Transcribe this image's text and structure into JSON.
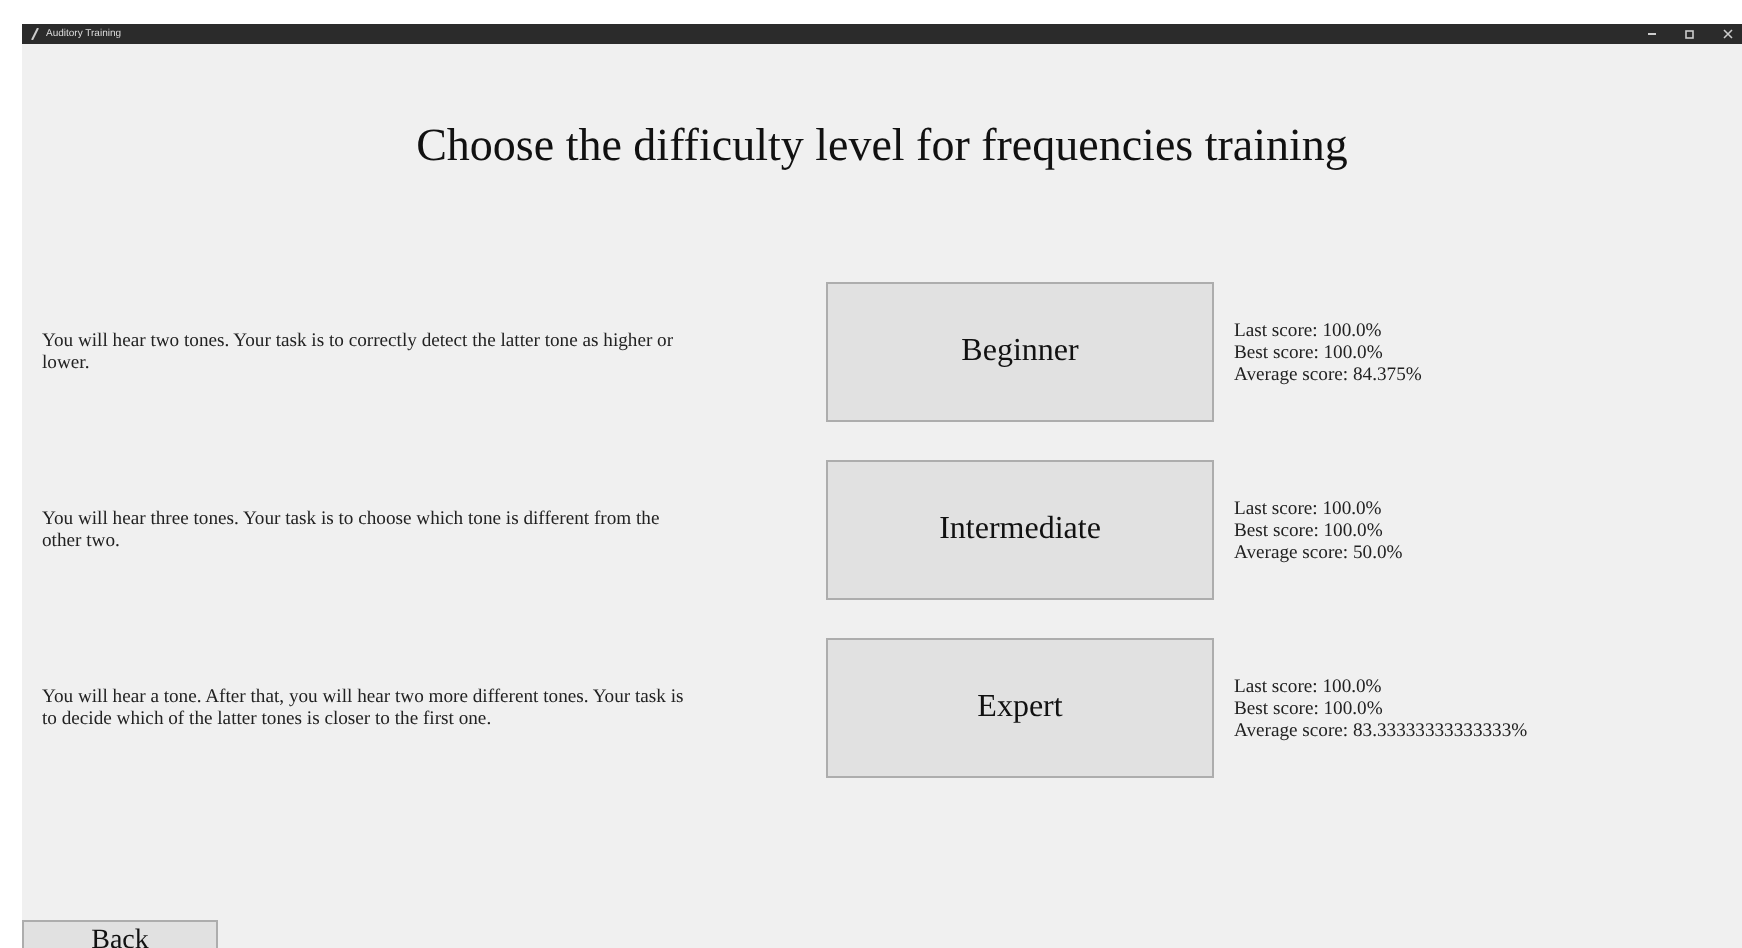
{
  "window": {
    "title": "Auditory Training"
  },
  "heading": "Choose the difficulty level for frequencies training",
  "levels": [
    {
      "description": "You will hear two tones. Your task is to correctly detect the latter tone as higher or lower.",
      "button": "Beginner",
      "stats": [
        "Last score: 100.0%",
        "Best score: 100.0%",
        "Average score: 84.375%"
      ]
    },
    {
      "description": "You will hear three tones. Your task is to choose which tone is different from the other two.",
      "button": "Intermediate",
      "stats": [
        "Last score: 100.0%",
        "Best score: 100.0%",
        "Average score: 50.0%"
      ]
    },
    {
      "description": "You will hear a tone. After that, you will hear two more different tones. Your task is to decide which of the latter tones is closer to the first one.",
      "button": "Expert",
      "stats": [
        "Last score: 100.0%",
        "Best score: 100.0%",
        "Average score: 83.33333333333333%"
      ]
    }
  ],
  "back_button": "Back"
}
